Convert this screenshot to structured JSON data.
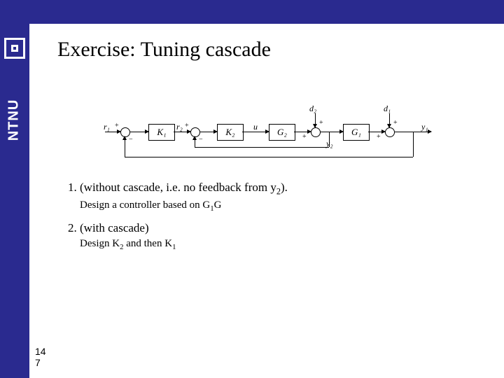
{
  "brand": {
    "name": "NTNU"
  },
  "slide": {
    "title": "Exercise: Tuning cascade",
    "page_a": "14",
    "page_b": "7",
    "items": [
      {
        "label_html": "(without cascade, i.e. no feedback from y<sub>2</sub>).",
        "sub_html": "Design a controller based on G<sub>1</sub>G"
      },
      {
        "label_html": "(with cascade)",
        "sub_html": "Design K<sub>2</sub> and then K<sub>1</sub>"
      }
    ]
  },
  "diagram": {
    "signals": {
      "r1": "r₁",
      "r2": "r₂",
      "u": "u",
      "d2": "d₂",
      "d1": "d₁",
      "y1": "y₁",
      "y2": "y₂"
    },
    "blocks": {
      "K1": "K₁",
      "K2": "K₂",
      "G2": "G₂",
      "G1": "G₁"
    }
  }
}
